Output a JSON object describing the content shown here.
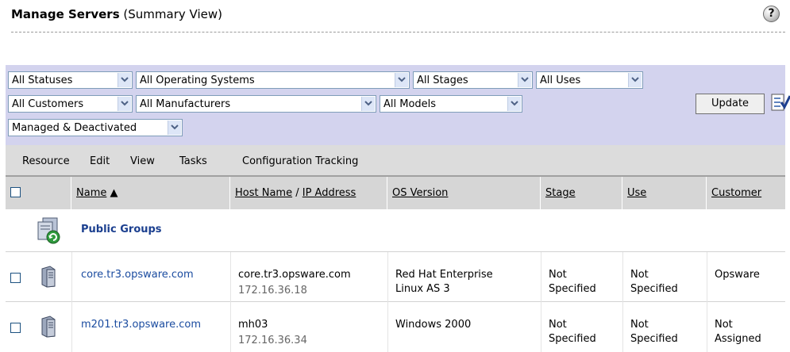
{
  "header": {
    "title_bold": "Manage Servers",
    "title_rest": " (Summary View)",
    "help_icon": "question-mark-icon"
  },
  "filters": {
    "row1": [
      "All Statuses",
      "All Operating Systems",
      "All Stages",
      "All Uses"
    ],
    "row2": [
      "All Customers",
      "All Manufacturers",
      "All Models"
    ],
    "row3": [
      "Managed & Deactivated"
    ],
    "update_label": "Update"
  },
  "menu": [
    "Resource",
    "Edit",
    "View",
    "Tasks",
    "Configuration Tracking"
  ],
  "table": {
    "columns": {
      "name": "Name",
      "host": "Host Name",
      "slash": " / ",
      "ip": "IP Address",
      "os": "OS Version",
      "stage": "Stage",
      "use": "Use",
      "customer": "Customer"
    },
    "sort_indicator": "▲",
    "group": {
      "label": "Public Groups"
    },
    "rows": [
      {
        "name": "core.tr3.opsware.com",
        "host": "core.tr3.opsware.com",
        "ip": "172.16.36.18",
        "os_line1": "Red Hat Enterprise",
        "os_line2": "Linux AS 3",
        "stage_line1": "Not",
        "stage_line2": "Specified",
        "use_line1": "Not",
        "use_line2": "Specified",
        "customer_line1": "Opsware",
        "customer_line2": ""
      },
      {
        "name": "m201.tr3.opsware.com",
        "host": "mh03",
        "ip": "172.16.36.34",
        "os_line1": "Windows 2000",
        "os_line2": "",
        "stage_line1": "Not",
        "stage_line2": "Specified",
        "use_line1": "Not",
        "use_line2": "Specified",
        "customer_line1": "Not",
        "customer_line2": "Assigned"
      }
    ]
  }
}
